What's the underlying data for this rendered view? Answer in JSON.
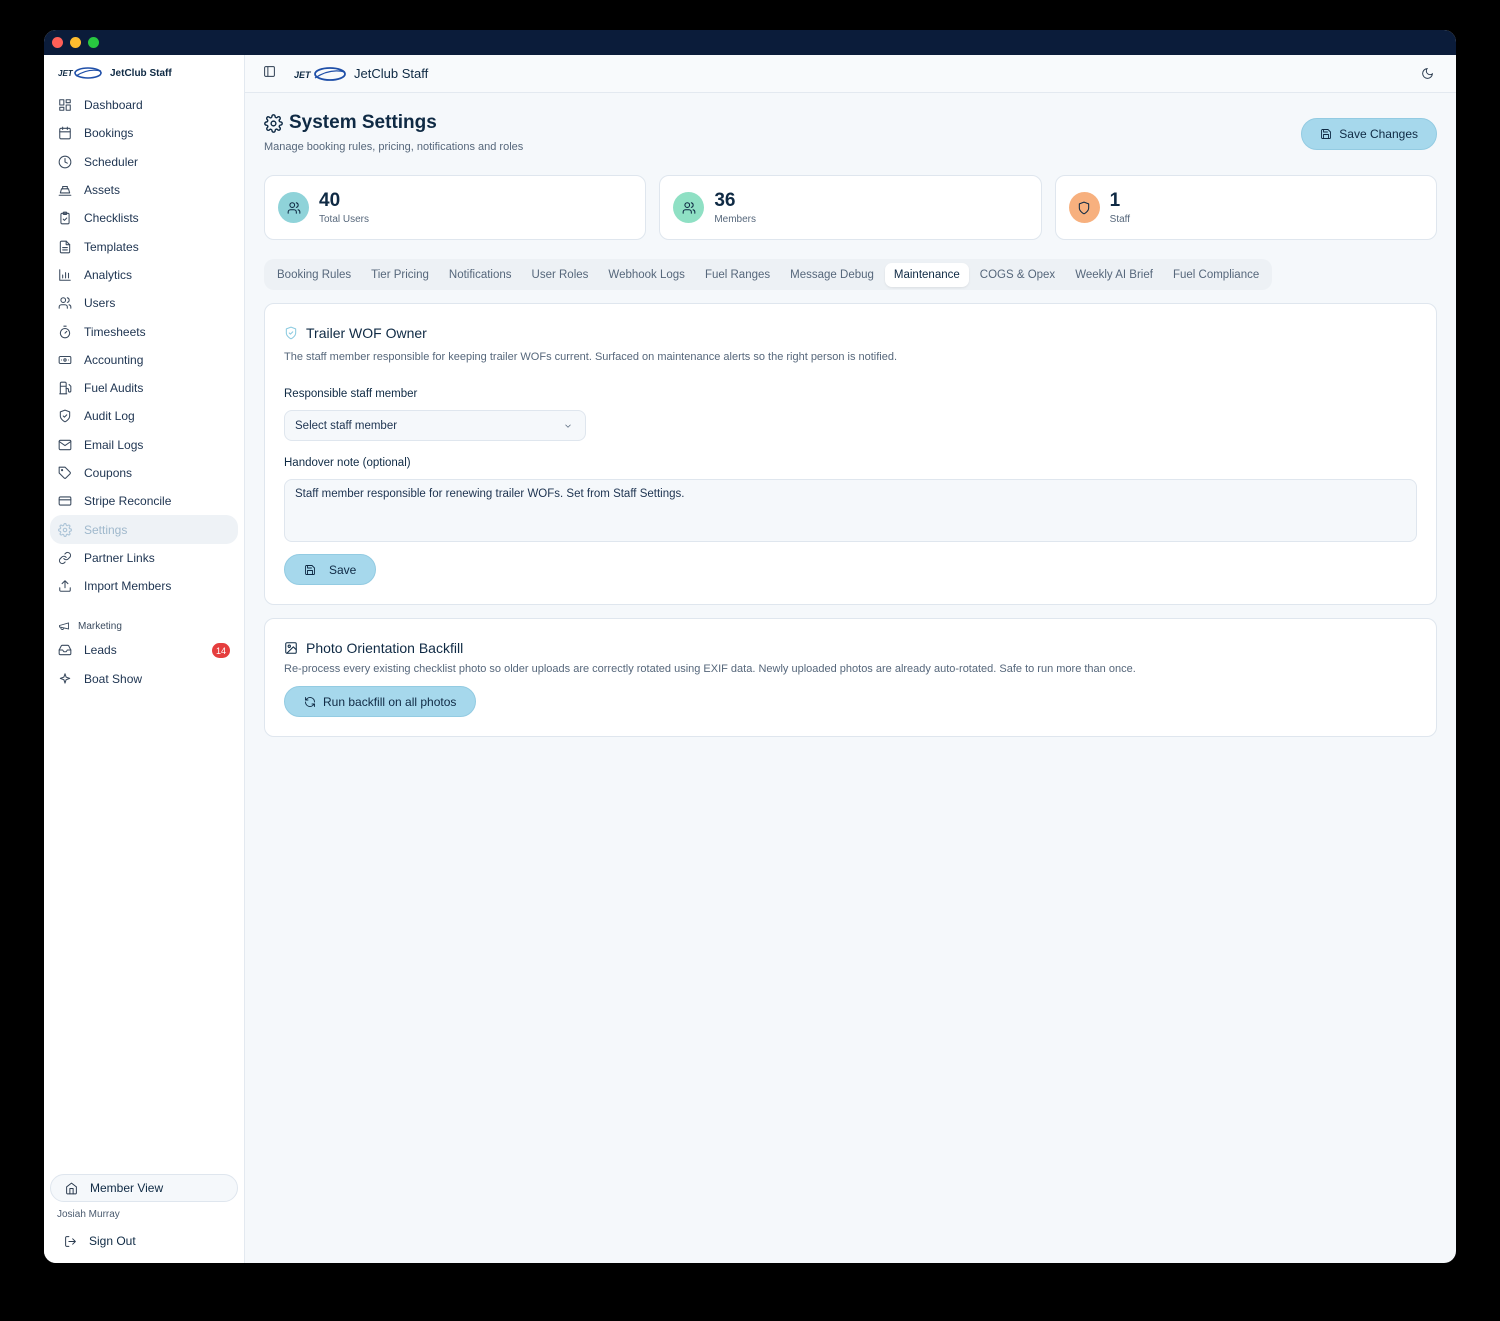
{
  "brand": {
    "logo_text": "JET",
    "name": "JetClub Staff"
  },
  "sidebar": {
    "items": [
      {
        "label": "Dashboard",
        "icon": "dashboard-icon"
      },
      {
        "label": "Bookings",
        "icon": "calendar-icon"
      },
      {
        "label": "Scheduler",
        "icon": "clock-icon"
      },
      {
        "label": "Assets",
        "icon": "assets-icon"
      },
      {
        "label": "Checklists",
        "icon": "clipboard-check-icon"
      },
      {
        "label": "Templates",
        "icon": "file-text-icon"
      },
      {
        "label": "Analytics",
        "icon": "bar-chart-icon"
      },
      {
        "label": "Users",
        "icon": "users-icon"
      },
      {
        "label": "Timesheets",
        "icon": "timer-icon"
      },
      {
        "label": "Accounting",
        "icon": "banknote-icon"
      },
      {
        "label": "Fuel Audits",
        "icon": "fuel-icon"
      },
      {
        "label": "Audit Log",
        "icon": "shield-icon"
      },
      {
        "label": "Email Logs",
        "icon": "mail-icon"
      },
      {
        "label": "Coupons",
        "icon": "tag-icon"
      },
      {
        "label": "Stripe Reconcile",
        "icon": "credit-card-icon"
      },
      {
        "label": "Settings",
        "icon": "gear-icon",
        "active": true
      },
      {
        "label": "Partner Links",
        "icon": "link-icon"
      },
      {
        "label": "Import Members",
        "icon": "upload-icon"
      }
    ],
    "marketing_label": "Marketing",
    "marketing_items": [
      {
        "label": "Leads",
        "icon": "inbox-icon",
        "badge": "14"
      },
      {
        "label": "Boat Show",
        "icon": "sparkle-icon"
      }
    ],
    "member_view": "Member View",
    "user_name": "Josiah Murray",
    "sign_out": "Sign Out"
  },
  "topbar": {
    "title": "JetClub Staff"
  },
  "page": {
    "title": "System Settings",
    "subtitle": "Manage booking rules, pricing, notifications and roles",
    "save_changes": "Save Changes"
  },
  "stats": [
    {
      "value": "40",
      "label": "Total Users",
      "color": "#8fd3d9",
      "icon": "users-icon"
    },
    {
      "value": "36",
      "label": "Members",
      "color": "#8fe0c4",
      "icon": "users-icon"
    },
    {
      "value": "1",
      "label": "Staff",
      "color": "#f7b07e",
      "icon": "shield-icon"
    }
  ],
  "tabs": [
    {
      "label": "Booking Rules"
    },
    {
      "label": "Tier Pricing"
    },
    {
      "label": "Notifications"
    },
    {
      "label": "User Roles"
    },
    {
      "label": "Webhook Logs"
    },
    {
      "label": "Fuel Ranges"
    },
    {
      "label": "Message Debug"
    },
    {
      "label": "Maintenance",
      "active": true
    },
    {
      "label": "COGS & Opex"
    },
    {
      "label": "Weekly AI Brief"
    },
    {
      "label": "Fuel Compliance"
    }
  ],
  "wof": {
    "title": "Trailer WOF Owner",
    "description": "The staff member responsible for keeping trailer WOFs current. Surfaced on maintenance alerts so the right person is notified.",
    "responsible_label": "Responsible staff member",
    "select_value": "Select staff member",
    "note_label": "Handover note (optional)",
    "note_value": "Staff member responsible for renewing trailer WOFs. Set from Staff Settings.",
    "save_label": "Save"
  },
  "photo": {
    "title": "Photo Orientation Backfill",
    "description": "Re-process every existing checklist photo so older uploads are correctly rotated using EXIF data. Newly uploaded photos are already auto-rotated. Safe to run more than once.",
    "run_label": "Run backfill on all photos"
  },
  "colors": {
    "accent": "#a6d8ec",
    "danger": "#e53e3e",
    "titlebar": "#0b1c3a"
  }
}
